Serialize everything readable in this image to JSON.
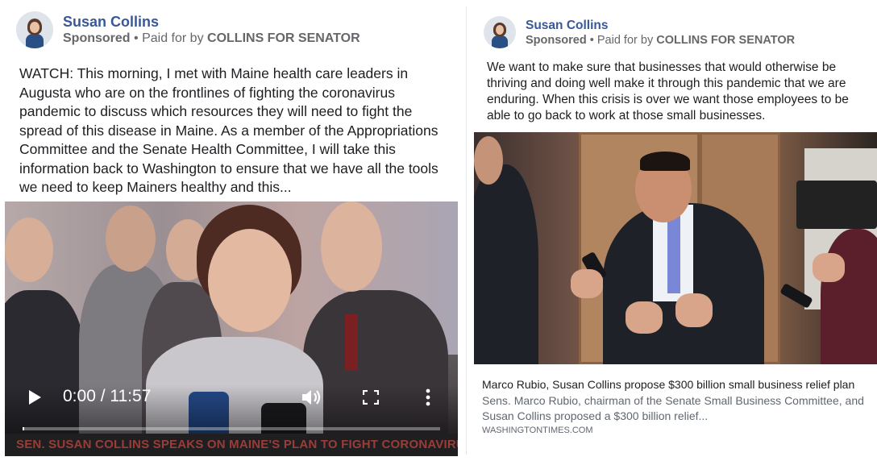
{
  "left_post": {
    "author": "Susan Collins",
    "sponsored": "Sponsored",
    "paid_for_prefix": "Paid for by",
    "paid_for_org": "COLLINS FOR SENATOR",
    "text": "WATCH: This morning, I met with Maine health care leaders in Augusta who are on the frontlines of fighting the coronavirus pandemic to discuss which resources they will need to fight the spread of this disease in Maine. As a member of the Appropriations Committee and the Senate Health Committee, I will take this information back to Washington to ensure that we have all the tools we need to keep Mainers healthy and this...",
    "video": {
      "time": "0:00 / 11:57",
      "caption": "SEN. SUSAN COLLINS SPEAKS ON MAINE'S PLAN TO FIGHT CORONAVIRUS",
      "progress_fraction": 0
    }
  },
  "right_post": {
    "author": "Susan Collins",
    "sponsored": "Sponsored",
    "paid_for_prefix": "Paid for by",
    "paid_for_org": "COLLINS FOR SENATOR",
    "text": "We want to make sure that businesses that would otherwise be thriving and doing well make it through this pandemic that we are enduring. When this crisis is over we want those employees to be able to go back to work at those small businesses.",
    "link": {
      "title": "Marco Rubio, Susan Collins propose $300 billion small business relief plan",
      "description": "Sens. Marco Rubio, chairman of the Senate Small Business Committee, and Susan Collins proposed a $300 billion relief...",
      "domain": "WASHINGTONTIMES.COM"
    }
  },
  "colors": {
    "author_blue": "#385898",
    "meta_gray": "#65676b",
    "caption_red": "#9a3d37"
  },
  "icons": [
    "play-icon",
    "volume-icon",
    "fullscreen-icon",
    "more-options-icon"
  ]
}
